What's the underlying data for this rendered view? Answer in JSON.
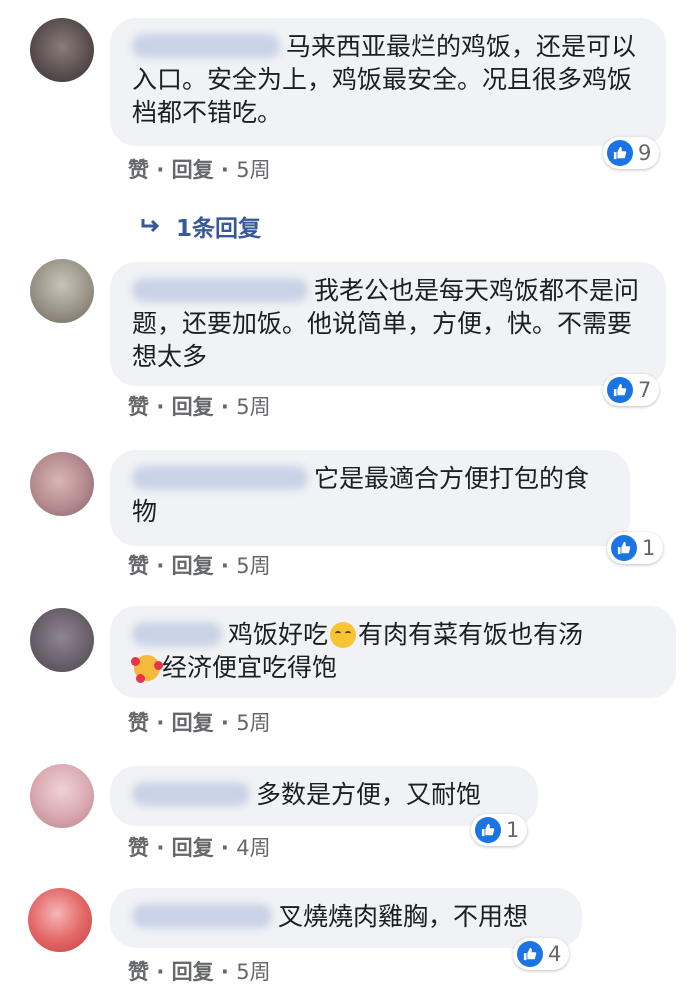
{
  "comments": [
    {
      "text": "马来西亚最烂的鸡饭，还是可以入口。安全为上，鸡饭最安全。况且很多鸡饭档都不错吃。",
      "reaction_count": "9",
      "actions": {
        "like": "赞",
        "reply": "回复",
        "time": "5周"
      },
      "avatar_color": "#5a5050"
    },
    {
      "text": "我老公也是每天鸡饭都不是问题，还要加饭。他说简单，方便，快。不需要想太多",
      "reaction_count": "7",
      "actions": {
        "like": "赞",
        "reply": "回复",
        "time": "5周"
      },
      "avatar_color": "#8a857a"
    },
    {
      "text": "它是最適合方便打包的食物",
      "reaction_count": "1",
      "actions": {
        "like": "赞",
        "reply": "回复",
        "time": "5周"
      },
      "avatar_color": "#b98c8f"
    },
    {
      "text_a": "鸡饭好吃",
      "text_b": "有肉有菜有饭也有汤",
      "text_c": "经济便宜吃得饱",
      "emoji_1": "smiling-face-icon",
      "emoji_2": "smiling-face-with-hearts-icon",
      "actions": {
        "like": "赞",
        "reply": "回复",
        "time": "5周"
      },
      "avatar_color": "#6e6670"
    },
    {
      "text": "多数是方便，又耐饱",
      "reaction_count": "1",
      "actions": {
        "like": "赞",
        "reply": "回复",
        "time": "4周"
      },
      "avatar_color": "#d4a6ad"
    },
    {
      "text": "叉燒燒肉雞胸，不用想",
      "reaction_count": "4",
      "actions": {
        "like": "赞",
        "reply": "回复",
        "time": "5周"
      },
      "avatar_color": "#e05a5a"
    }
  ],
  "replies_link": {
    "label": "1条回复"
  },
  "separator": "·",
  "colors": {
    "bubble": "#f0f2f5",
    "like_blue": "#1b74e4",
    "meta_gray": "#65676b",
    "link_blue": "#385898"
  }
}
